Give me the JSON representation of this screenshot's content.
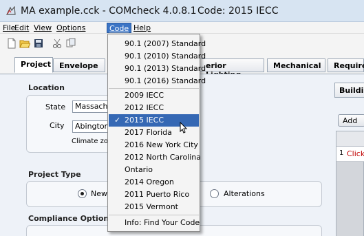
{
  "window": {
    "title": "MA example.cck - COMcheck 4.0.8.1",
    "code_label": "Code: 2015 IECC"
  },
  "menubar": {
    "items": [
      "File",
      "Edit",
      "View",
      "Options",
      "Code",
      "Help"
    ],
    "active": "Code"
  },
  "toolbar": {
    "icons": [
      "new-file-icon",
      "open-folder-icon",
      "save-icon",
      "cut-icon",
      "copy-icon"
    ]
  },
  "tabs": [
    "Project",
    "Envelope",
    "Interior Lighting",
    "Mechanical",
    "Requirements"
  ],
  "tabs_visible": [
    "Project",
    "Envelope",
    "erior Lighting",
    "Mechanical",
    "Require"
  ],
  "location": {
    "title": "Location",
    "state_label": "State",
    "state_value": "Massachusetts",
    "state_visible": "Massach",
    "city_label": "City",
    "city_value": "Abington",
    "city_visible": "Abington",
    "climate_label": "Climate zone"
  },
  "project_type": {
    "title": "Project Type",
    "option_new": "New",
    "option_alterations": "Alterations",
    "selected": "New"
  },
  "compliance": {
    "title": "Compliance Options"
  },
  "right_panel": {
    "subtab": "Building",
    "add_button": "Add",
    "row_number": "1",
    "row_text": "Click"
  },
  "code_menu": {
    "items": [
      "90.1 (2007) Standard",
      "90.1 (2010) Standard",
      "90.1 (2013) Standard",
      "90.1 (2016) Standard",
      "2009 IECC",
      "2012 IECC",
      "2015 IECC",
      "2017 Florida",
      "2016 New York City",
      "2012 North Carolina",
      "Ontario",
      "2014 Oregon",
      "2011 Puerto Rico",
      "2015 Vermont",
      "Info: Find Your Code"
    ],
    "selected": "2015 IECC",
    "check_mark": "✓"
  }
}
